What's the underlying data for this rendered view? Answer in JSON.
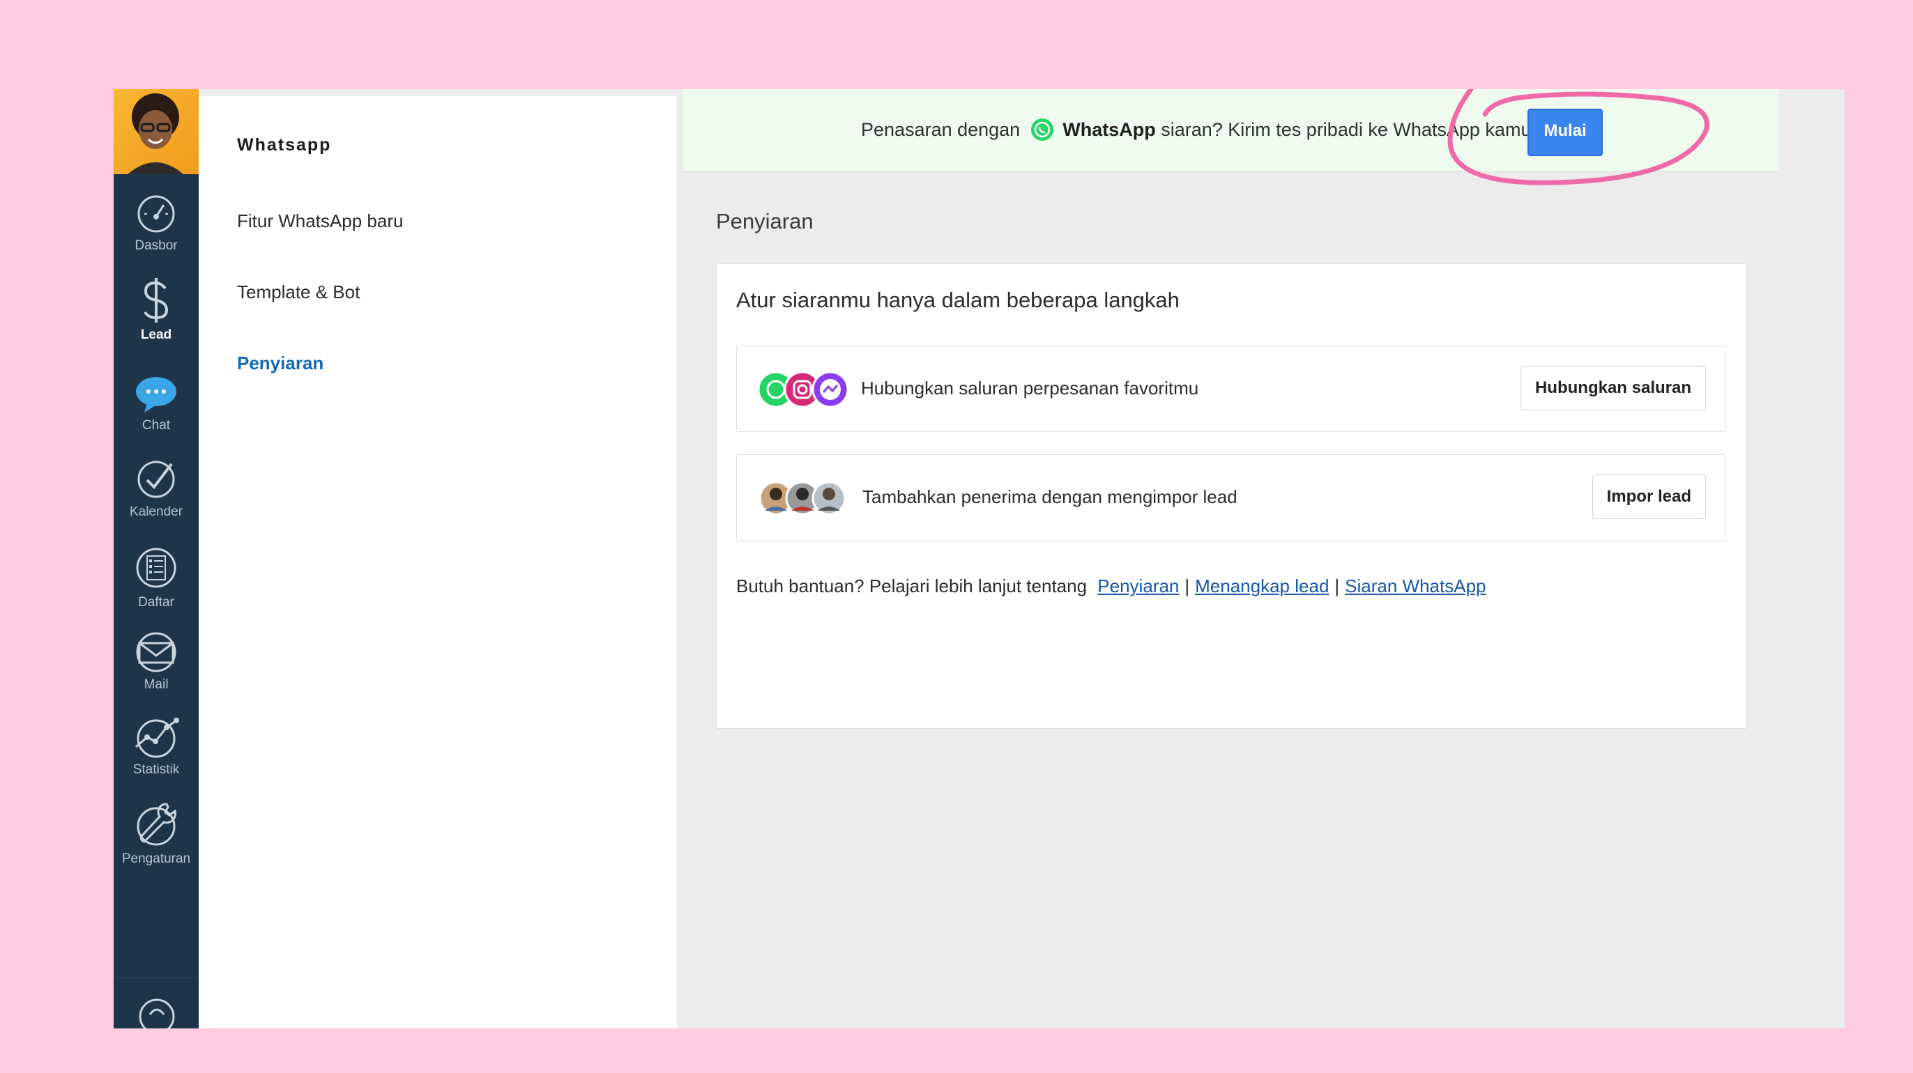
{
  "rail": {
    "items": [
      {
        "label": "Dasbor",
        "icon": "speedometer-icon"
      },
      {
        "label": "Lead",
        "icon": "dollar-icon",
        "active": true
      },
      {
        "label": "Chat",
        "icon": "chat-bubble-icon"
      },
      {
        "label": "Kalender",
        "icon": "check-circle-icon"
      },
      {
        "label": "Daftar",
        "icon": "list-icon"
      },
      {
        "label": "Mail",
        "icon": "mail-icon"
      },
      {
        "label": "Statistik",
        "icon": "chart-icon"
      },
      {
        "label": "Pengaturan",
        "icon": "wrench-icon"
      }
    ]
  },
  "subnav": {
    "title": "Whatsapp",
    "items": [
      {
        "label": "Fitur WhatsApp baru"
      },
      {
        "label": "Template & Bot"
      },
      {
        "label": "Penyiaran",
        "active": true
      }
    ]
  },
  "banner": {
    "prefix": "Penasaran dengan",
    "brand": "WhatsApp",
    "suffix": "siaran? Kirim tes pribadi ke WhatsApp kamu.",
    "button": "Mulai"
  },
  "main": {
    "page_title": "Penyiaran",
    "card_title": "Atur siaranmu hanya dalam beberapa langkah",
    "steps": [
      {
        "text": "Hubungkan saluran perpesanan favoritmu",
        "button": "Hubungkan saluran"
      },
      {
        "text": "Tambahkan penerima dengan mengimpor lead",
        "button": "Impor lead"
      }
    ],
    "help": {
      "prefix": "Butuh bantuan? Pelajari lebih lanjut tentang",
      "links": [
        "Penyiaran",
        "Menangkap lead",
        "Siaran WhatsApp"
      ],
      "separator": "|"
    }
  },
  "colors": {
    "background": "#fecbe1",
    "rail": "#1e3448",
    "accent": "#3a86f0",
    "active_link": "#1469b8",
    "annotation": "#f06aa8",
    "whatsapp": "#25d366"
  }
}
